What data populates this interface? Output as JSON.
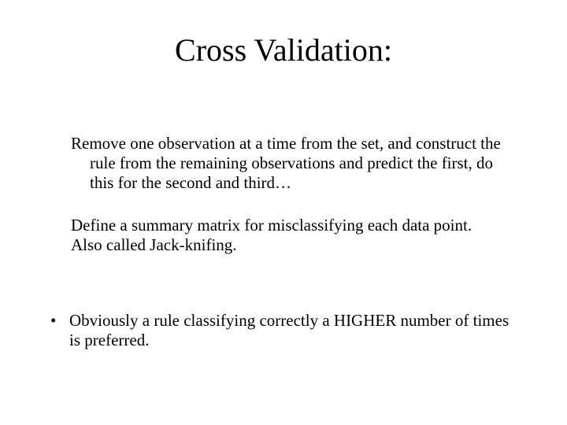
{
  "title": "Cross Validation:",
  "para1": "Remove one observation at a time from the set, and construct the rule from the remaining observations and predict the first, do this for the second and third…",
  "para2": "Define a summary matrix for misclassifying each data point.",
  "para3": "Also called Jack-knifing.",
  "bullet_dot": "•",
  "bullet1": "Obviously a rule classifying correctly a HIGHER number of times is preferred."
}
